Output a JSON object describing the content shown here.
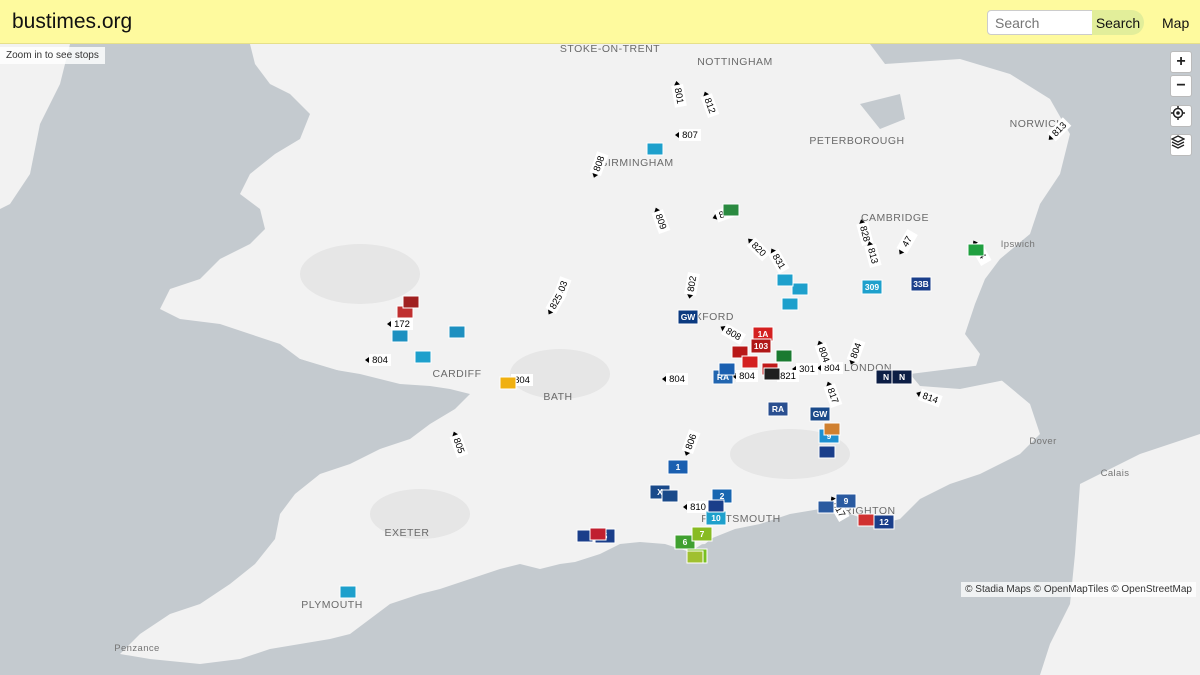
{
  "header": {
    "logo": "bustimes.org",
    "search_placeholder": "Search",
    "search_button": "Search",
    "nav_map": "Map"
  },
  "map": {
    "zoom_hint": "Zoom in to see stops",
    "attribution": "© Stadia Maps © OpenMapTiles © OpenStreetMap",
    "controls": {
      "zoom_in": "+",
      "zoom_out": "−"
    },
    "places": [
      "STOKE-ON-TRENT",
      "NOTTINGHAM",
      "NORWICH",
      "PETERBOROUGH",
      "BIRMINGHAM",
      "CAMBRIDGE",
      "Ipswich",
      "OXFORD",
      "CARDIFF",
      "BATH",
      "LONDON",
      "Dover",
      "Calais",
      "PORTSMOUTH",
      "BRIGHTON",
      "EXETER",
      "PLYMOUTH",
      "Penzance"
    ],
    "route_labels": [
      "801",
      "812",
      "807",
      "808",
      "809",
      "820",
      "820",
      "831",
      "828",
      "813",
      "47",
      "24",
      "803",
      "825",
      "802",
      "804",
      "804",
      "804",
      "804",
      "804",
      "804",
      "806",
      "805",
      "810",
      "817",
      "817",
      "814",
      "813",
      "301",
      "821",
      "172",
      "804",
      "808"
    ],
    "vehicle_labels": [
      "1A",
      "103",
      "GW",
      "RA",
      "RA",
      "GW",
      "309",
      "33B",
      "N",
      "N",
      "5",
      "2",
      "10",
      "3",
      "9",
      "12",
      "1",
      "6",
      "7",
      "9",
      "X"
    ],
    "colors": {
      "sea": "#c4cacf",
      "land": "#f2f2f2",
      "header": "#fefa9e"
    }
  }
}
